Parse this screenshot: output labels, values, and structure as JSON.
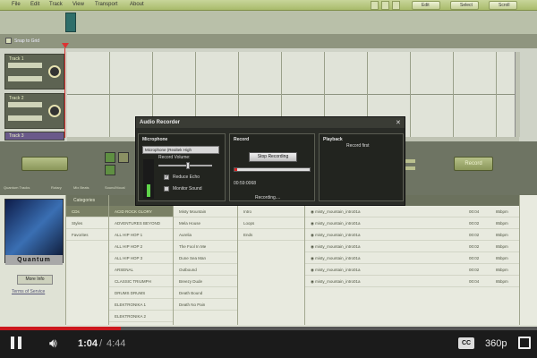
{
  "colors": {
    "accent_green": "#a9bb6c",
    "video_progress": "#cc181e"
  },
  "menubar": {
    "items": [
      "File",
      "Edit",
      "Track",
      "View",
      "Transport",
      "About"
    ],
    "buttons": {
      "edit": "Edit",
      "select": "Select",
      "scroll": "Scroll"
    }
  },
  "editor": {
    "snap_label": "Snap to Grid",
    "tracks": [
      "Track 1",
      "Track 2",
      "Track 3"
    ]
  },
  "toolbar": {
    "tabs": [
      "Quantum Tracks",
      "Rotary",
      "Mix Beats",
      "Sound/Vocal"
    ],
    "stop_label": "Record"
  },
  "browser": {
    "more_info": "More Info",
    "terms": "Terms of Service",
    "logo": "Quantum",
    "categories_header": "Categories",
    "categories": [
      "CDs",
      "Styles",
      "Favorites"
    ],
    "genres": [
      "ACID ROCK GLORY",
      "ADVENTURES BEYOND",
      "ALL HIP HOP 1",
      "ALL HIP HOP 2",
      "ALL HIP HOP 3",
      "ARSENAL",
      "CLASSIC TRIUMPH",
      "DRUMS DRUMS",
      "ELEKTRONIKA 1",
      "ELEKTRONIKA 2",
      "ELEKTRONIKA 3"
    ],
    "songs": [
      "Misty Mountain",
      "Mela House",
      "Aurelia",
      "The Fool In Me",
      "Dune Sea Man",
      "Outbound",
      "Breezy Dude",
      "Death Bound",
      "Death No Pain"
    ],
    "parts": [
      "Intro",
      "Loops",
      "Ends"
    ],
    "files": [
      {
        "name": "misty_mountain_intro01a",
        "time": "00:04",
        "bpm": "85bpm"
      },
      {
        "name": "misty_mountain_intro01a",
        "time": "00:02",
        "bpm": "85bpm"
      },
      {
        "name": "misty_mountain_intro01a",
        "time": "00:02",
        "bpm": "85bpm"
      },
      {
        "name": "misty_mountain_intro01a",
        "time": "00:02",
        "bpm": "85bpm"
      },
      {
        "name": "misty_mountain_intro01a",
        "time": "00:02",
        "bpm": "85bpm"
      },
      {
        "name": "misty_mountain_intro01a",
        "time": "00:02",
        "bpm": "85bpm"
      },
      {
        "name": "misty_mountain_intro01a",
        "time": "00:04",
        "bpm": "85bpm"
      }
    ]
  },
  "dialog": {
    "title": "Audio Recorder",
    "microphone_title": "Microphone",
    "device": "Microphone (Realtek High",
    "record_volume": "Record Volume:",
    "volume_level": 0.55,
    "reduce_echo": "Reduce Echo",
    "monitor_sound": "Monitor Sound",
    "record_title": "Record",
    "stop_button": "Stop Recording",
    "time": "00:59:0068",
    "status": "Recording....",
    "playback_title": "Playback",
    "playback_hint": "Record first"
  },
  "player": {
    "current": "1:04",
    "separator": "/",
    "duration": "4:44",
    "progress": 0.225,
    "quality": "360p",
    "cc": "CC"
  }
}
